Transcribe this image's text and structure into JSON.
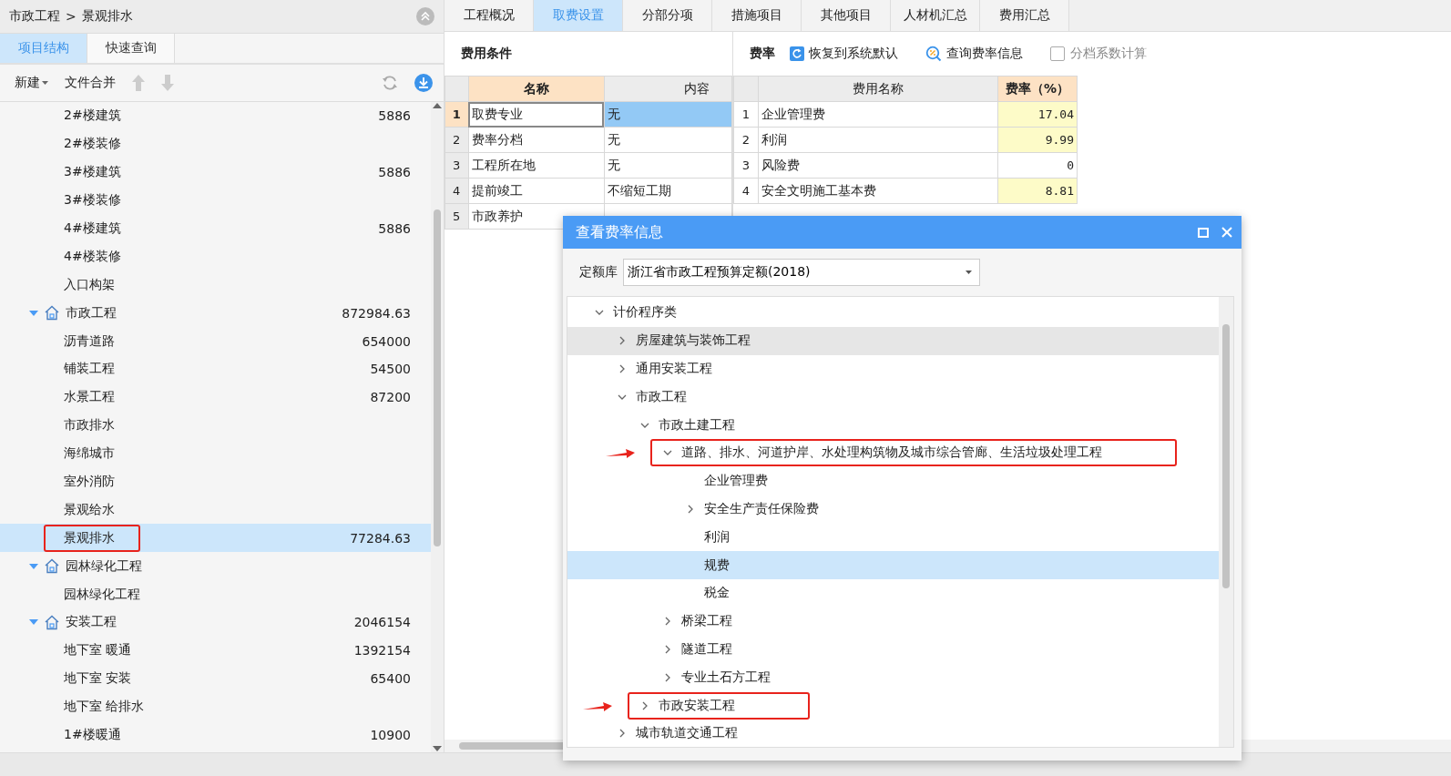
{
  "breadcrumb": {
    "path": "市政工程",
    "separator": ">",
    "current": "景观排水"
  },
  "left_tabs": [
    {
      "label": "项目结构",
      "selected": true
    },
    {
      "label": "快速查询",
      "selected": false
    }
  ],
  "toolbar": {
    "new": "新建",
    "merge": "文件合并"
  },
  "project_tree": [
    {
      "kind": "unit",
      "label": "2#楼建筑",
      "value": "5886",
      "selected": false,
      "highlighted": false
    },
    {
      "kind": "unit",
      "label": "2#楼装修",
      "selected": false,
      "highlighted": false
    },
    {
      "kind": "unit",
      "label": "3#楼建筑",
      "value": "5886",
      "selected": false,
      "highlighted": false
    },
    {
      "kind": "unit",
      "label": "3#楼装修",
      "selected": false,
      "highlighted": false
    },
    {
      "kind": "unit",
      "label": "4#楼建筑",
      "value": "5886",
      "selected": false,
      "highlighted": false
    },
    {
      "kind": "unit",
      "label": "4#楼装修",
      "selected": false,
      "highlighted": false
    },
    {
      "kind": "unit",
      "label": "入口构架",
      "selected": false,
      "highlighted": false
    },
    {
      "kind": "project",
      "label": "市政工程",
      "value": "872984.63",
      "expanded": true,
      "selected": false,
      "highlighted": false,
      "children": [
        {
          "kind": "unit",
          "label": "沥青道路",
          "value": "654000",
          "selected": false,
          "highlighted": false
        },
        {
          "kind": "unit",
          "label": "铺装工程",
          "value": "54500",
          "selected": false,
          "highlighted": false
        },
        {
          "kind": "unit",
          "label": "水景工程",
          "value": "87200",
          "selected": false,
          "highlighted": false
        },
        {
          "kind": "unit",
          "label": "市政排水",
          "selected": false,
          "highlighted": false
        },
        {
          "kind": "unit",
          "label": "海绵城市",
          "selected": false,
          "highlighted": false
        },
        {
          "kind": "unit",
          "label": "室外消防",
          "selected": false,
          "highlighted": false
        },
        {
          "kind": "unit",
          "label": "景观给水",
          "selected": false,
          "highlighted": false
        },
        {
          "kind": "unit",
          "label": "景观排水",
          "value": "77284.63",
          "selected": true,
          "highlighted": true
        }
      ]
    },
    {
      "kind": "project",
      "label": "园林绿化工程",
      "expanded": true,
      "selected": false,
      "highlighted": false,
      "children": [
        {
          "kind": "unit",
          "label": "园林绿化工程",
          "selected": false,
          "highlighted": false
        }
      ]
    },
    {
      "kind": "project",
      "label": "安装工程",
      "value": "2046154",
      "expanded": true,
      "selected": false,
      "highlighted": false,
      "children": [
        {
          "kind": "unit",
          "label": "地下室 暖通",
          "value": "1392154",
          "selected": false,
          "highlighted": false
        },
        {
          "kind": "unit",
          "label": "地下室 安装",
          "value": "65400",
          "selected": false,
          "highlighted": false
        },
        {
          "kind": "unit",
          "label": "地下室 给排水",
          "selected": false,
          "highlighted": false
        },
        {
          "kind": "unit",
          "label": "1#楼暖通",
          "value": "10900",
          "selected": false,
          "highlighted": false
        }
      ]
    }
  ],
  "main_tabs": [
    {
      "label": "工程概况",
      "selected": false
    },
    {
      "label": "取费设置",
      "selected": true
    },
    {
      "label": "分部分项",
      "selected": false
    },
    {
      "label": "措施项目",
      "selected": false
    },
    {
      "label": "其他项目",
      "selected": false
    },
    {
      "label": "人材机汇总",
      "selected": false
    },
    {
      "label": "费用汇总",
      "selected": false
    }
  ],
  "conditions": {
    "title": "费用条件",
    "columns": [
      "名称",
      "内容"
    ],
    "rows": [
      {
        "index": "1",
        "name": "取费专业",
        "content": "无",
        "selected": true
      },
      {
        "index": "2",
        "name": "费率分档",
        "content": "无",
        "selected": false
      },
      {
        "index": "3",
        "name": "工程所在地",
        "content": "无",
        "selected": false
      },
      {
        "index": "4",
        "name": "提前竣工",
        "content": "不缩短工期",
        "selected": false
      },
      {
        "index": "5",
        "name": "市政养护",
        "selected": false
      }
    ]
  },
  "rates": {
    "title": "费率",
    "restore": "恢复到系统默认",
    "query": "查询费率信息",
    "tier_checkbox": {
      "label": "分档系数计算",
      "checked": false,
      "disabled": true
    },
    "columns": [
      "费用名称",
      "费率（%）"
    ],
    "rows": [
      {
        "index": "1",
        "name": "企业管理费",
        "rate": "17.04",
        "highlighted": true
      },
      {
        "index": "2",
        "name": "利润",
        "rate": "9.99",
        "highlighted": true
      },
      {
        "index": "3",
        "name": "风险费",
        "rate": "0",
        "highlighted": false
      },
      {
        "index": "4",
        "name": "安全文明施工基本费",
        "rate": "8.81",
        "highlighted": true
      }
    ]
  },
  "dialog": {
    "title": "查看费率信息",
    "library_label": "定额库",
    "library": "浙江省市政工程预算定额(2018)",
    "tree": [
      {
        "label": "计价程序类",
        "expanded": true,
        "selected": false,
        "hovered": false,
        "highlighted": false,
        "children": [
          {
            "label": "房屋建筑与装饰工程",
            "expanded": false,
            "selected": false,
            "hovered": true,
            "highlighted": false
          },
          {
            "label": "通用安装工程",
            "expanded": false,
            "selected": false,
            "hovered": false,
            "highlighted": false
          },
          {
            "label": "市政工程",
            "expanded": true,
            "selected": false,
            "hovered": false,
            "highlighted": false,
            "children": [
              {
                "label": "市政土建工程",
                "expanded": true,
                "selected": false,
                "hovered": false,
                "highlighted": false,
                "children": [
                  {
                    "label": "道路、排水、河道护岸、水处理构筑物及城市综合管廊、生活垃圾处理工程",
                    "expanded": true,
                    "selected": false,
                    "hovered": false,
                    "highlighted": true,
                    "children": [
                      {
                        "label": "企业管理费",
                        "selected": false,
                        "hovered": false,
                        "highlighted": false
                      },
                      {
                        "label": "安全生产责任保险费",
                        "expanded": false,
                        "selected": false,
                        "hovered": false,
                        "highlighted": false
                      },
                      {
                        "label": "利润",
                        "selected": false,
                        "hovered": false,
                        "highlighted": false
                      },
                      {
                        "label": "规费",
                        "selected": true,
                        "hovered": false,
                        "highlighted": false
                      },
                      {
                        "label": "税金",
                        "selected": false,
                        "hovered": false,
                        "highlighted": false
                      }
                    ]
                  },
                  {
                    "label": "桥梁工程",
                    "expanded": false,
                    "selected": false,
                    "hovered": false,
                    "highlighted": false
                  },
                  {
                    "label": "隧道工程",
                    "expanded": false,
                    "selected": false,
                    "hovered": false,
                    "highlighted": false
                  },
                  {
                    "label": "专业土石方工程",
                    "expanded": false,
                    "selected": false,
                    "hovered": false,
                    "highlighted": false
                  }
                ]
              },
              {
                "label": "市政安装工程",
                "expanded": false,
                "selected": false,
                "hovered": false,
                "highlighted": true
              }
            ]
          },
          {
            "label": "城市轨道交通工程",
            "expanded": false,
            "selected": false,
            "hovered": false,
            "highlighted": false
          }
        ]
      }
    ]
  }
}
